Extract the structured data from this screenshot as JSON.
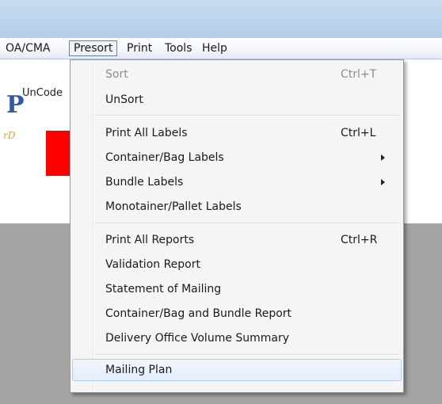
{
  "menubar": {
    "items": [
      {
        "label": "OA/CMA"
      },
      {
        "label": "Presort"
      },
      {
        "label": "Print"
      },
      {
        "label": "Tools"
      },
      {
        "label": "Help"
      }
    ]
  },
  "background": {
    "uncode_label": "UnCode",
    "logo_letter": "P",
    "logo_sub": "rD"
  },
  "presort_menu": {
    "items": [
      {
        "label": "Sort",
        "shortcut": "Ctrl+T",
        "disabled": true
      },
      {
        "label": "UnSort"
      },
      {
        "label": "Print All Labels",
        "shortcut": "Ctrl+L"
      },
      {
        "label": "Container/Bag Labels",
        "submenu": true
      },
      {
        "label": "Bundle Labels",
        "submenu": true
      },
      {
        "label": "Monotainer/Pallet Labels"
      },
      {
        "label": "Print All Reports",
        "shortcut": "Ctrl+R"
      },
      {
        "label": "Validation Report"
      },
      {
        "label": "Statement of Mailing"
      },
      {
        "label": "Container/Bag and Bundle Report"
      },
      {
        "label": "Delivery Office Volume Summary"
      },
      {
        "label": "Mailing Plan",
        "highlighted": true
      }
    ]
  }
}
